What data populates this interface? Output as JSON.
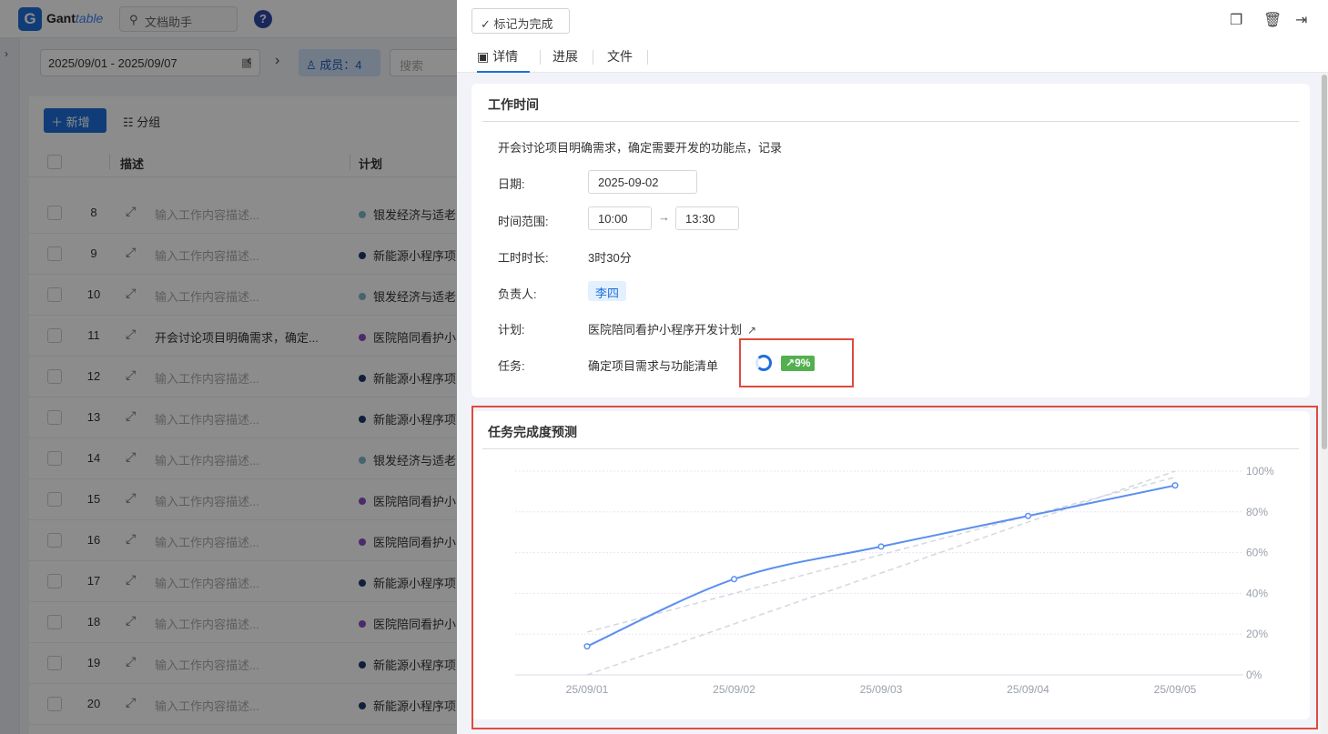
{
  "app": {
    "logo_letter": "G",
    "logo_name_main": "Gant",
    "logo_name_accent": "table",
    "search_label": "文档助手",
    "help_label": "?"
  },
  "filters": {
    "date_range": "2025/09/01 - 2025/09/07",
    "prev": "‹",
    "next": "›",
    "members_label": "成员：4",
    "search_placeholder": "搜索"
  },
  "toolbar": {
    "add_label": "新增",
    "group_label": "分组"
  },
  "table": {
    "headers": {
      "desc": "描述",
      "plan": "计划"
    },
    "placeholder": "输入工作内容描述...",
    "rows": [
      {
        "num": "8",
        "desc": "",
        "plan": "银发经济与适老",
        "color": "#7fb6c8"
      },
      {
        "num": "9",
        "desc": "",
        "plan": "新能源小程序项",
        "color": "#1f3a6e"
      },
      {
        "num": "10",
        "desc": "",
        "plan": "银发经济与适老",
        "color": "#7fb6c8"
      },
      {
        "num": "11",
        "desc": "开会讨论项目明确需求，确定...",
        "plan": "医院陪同看护小",
        "color": "#8a4fc2"
      },
      {
        "num": "12",
        "desc": "",
        "plan": "新能源小程序项",
        "color": "#1f3a6e"
      },
      {
        "num": "13",
        "desc": "",
        "plan": "新能源小程序项",
        "color": "#1f3a6e"
      },
      {
        "num": "14",
        "desc": "",
        "plan": "银发经济与适老",
        "color": "#7fb6c8"
      },
      {
        "num": "15",
        "desc": "",
        "plan": "医院陪同看护小",
        "color": "#8a4fc2"
      },
      {
        "num": "16",
        "desc": "",
        "plan": "医院陪同看护小",
        "color": "#8a4fc2"
      },
      {
        "num": "17",
        "desc": "",
        "plan": "新能源小程序项",
        "color": "#1f3a6e"
      },
      {
        "num": "18",
        "desc": "",
        "plan": "医院陪同看护小",
        "color": "#8a4fc2"
      },
      {
        "num": "19",
        "desc": "",
        "plan": "新能源小程序项",
        "color": "#1f3a6e"
      },
      {
        "num": "20",
        "desc": "",
        "plan": "新能源小程序项",
        "color": "#1f3a6e"
      }
    ]
  },
  "drawer": {
    "mark_done_label": "标记为完成",
    "tabs": [
      "详情",
      "进展",
      "文件"
    ],
    "work_time": {
      "title": "工作时间",
      "description": "开会讨论项目明确需求，确定需要开发的功能点，记录",
      "date_label": "日期:",
      "date_value": "2025-09-02",
      "range_label": "时间范围:",
      "start_time": "10:00",
      "end_time": "13:30",
      "duration_label": "工时时长:",
      "duration_value": "3时30分",
      "owner_label": "负责人:",
      "owner_value": "李四",
      "plan_label": "计划:",
      "plan_value": "医院陪同看护小程序开发计划",
      "task_label": "任务:",
      "task_value": "确定项目需求与功能清单",
      "task_progress": "9%"
    },
    "forecast_title": "任务完成度预测"
  },
  "chart_data": {
    "type": "line",
    "title": "任务完成度预测",
    "categories": [
      "25/09/01",
      "25/09/02",
      "25/09/03",
      "25/09/04",
      "25/09/05"
    ],
    "series": [
      {
        "values": [
          14,
          47,
          63,
          78,
          93
        ],
        "color": "#5b8ff0"
      }
    ],
    "trend_lines": [
      {
        "from": 0,
        "to": 100
      },
      {
        "from": 21,
        "to": 97
      }
    ],
    "y_ticks": [
      "0%",
      "20%",
      "40%",
      "60%",
      "80%",
      "100%"
    ],
    "ylim": [
      0,
      100
    ],
    "grid": true
  }
}
